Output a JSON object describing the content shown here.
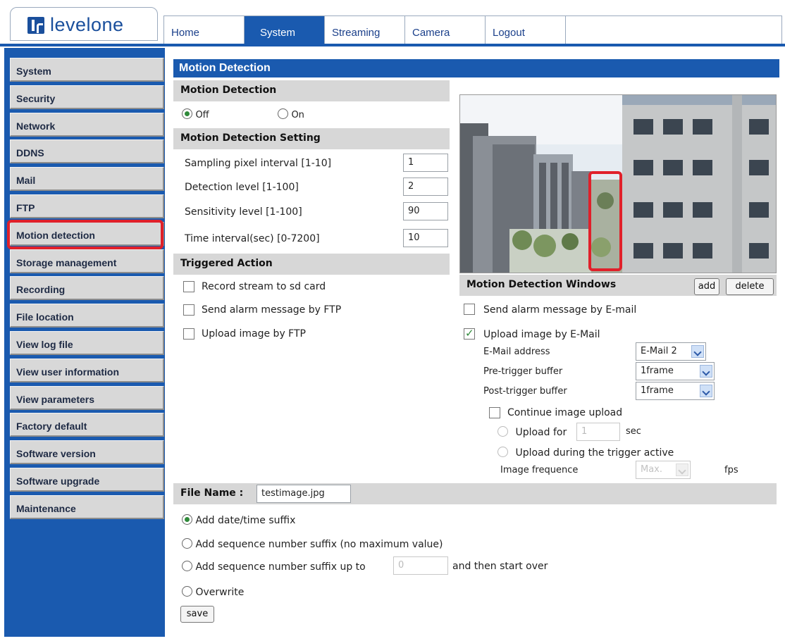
{
  "brand": {
    "logo_text": "levelone"
  },
  "nav": {
    "tabs": [
      "Home",
      "System",
      "Streaming",
      "Camera",
      "Logout"
    ],
    "active": "System"
  },
  "sidebar": {
    "items": [
      "System",
      "Security",
      "Network",
      "DDNS",
      "Mail",
      "FTP",
      "Motion detection",
      "Storage management",
      "Recording",
      "File location",
      "View log file",
      "View user information",
      "View parameters",
      "Factory default",
      "Software version",
      "Software upgrade",
      "Maintenance"
    ],
    "selected": "Motion detection"
  },
  "main": {
    "title": "Motion Detection",
    "motion_detection": {
      "header": "Motion Detection",
      "off_label": "Off",
      "on_label": "On",
      "selected": "Off"
    },
    "setting": {
      "header": "Motion Detection Setting",
      "rows": [
        {
          "label": "Sampling pixel interval [1-10]",
          "value": "1"
        },
        {
          "label": "Detection level [1-100]",
          "value": "2"
        },
        {
          "label": "Sensitivity level [1-100]",
          "value": "90"
        },
        {
          "label": "Time interval(sec) [0-7200]",
          "value": "10"
        }
      ]
    },
    "triggered": {
      "header": "Triggered Action",
      "left_options": [
        {
          "label": "Record stream to sd card",
          "checked": false
        },
        {
          "label": "Send alarm message by FTP",
          "checked": false
        },
        {
          "label": "Upload image by FTP",
          "checked": false
        }
      ]
    },
    "windows": {
      "header": "Motion Detection Windows",
      "add_label": "add",
      "delete_label": "delete"
    },
    "email": {
      "send_alarm_label": "Send alarm message by E-mail",
      "send_alarm_checked": false,
      "upload_label": "Upload image by E-Mail",
      "upload_checked": true,
      "address_label": "E-Mail address",
      "address_value": "E-Mail 2",
      "pre_label": "Pre-trigger buffer",
      "pre_value": "1frame",
      "post_label": "Post-trigger buffer",
      "post_value": "1frame",
      "continue_label": "Continue image upload",
      "upload_for_label": "Upload for",
      "upload_for_value": "1",
      "upload_for_unit": "sec",
      "during_label": "Upload during the trigger active",
      "freq_label": "Image frequence",
      "freq_value": "Max.",
      "freq_unit": "fps"
    },
    "file": {
      "label": "File Name :",
      "value": "testimage.jpg",
      "options": [
        "Add date/time suffix",
        "Add sequence number suffix (no maximum value)",
        "Add sequence number suffix up to",
        "Overwrite"
      ],
      "selected": "Add date/time suffix",
      "upto_value": "0",
      "upto_suffix": "and then start over",
      "save_label": "save"
    }
  },
  "colors": {
    "brand_blue": "#1a5aaf",
    "highlight_red": "#e0202a",
    "section_gray": "#d7d7d7"
  }
}
